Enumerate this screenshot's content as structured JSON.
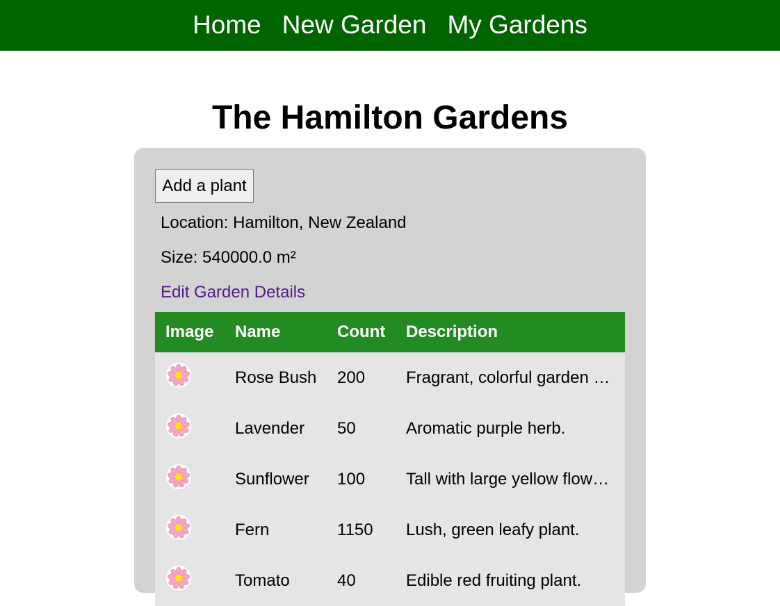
{
  "nav": {
    "items": [
      {
        "label": "Home"
      },
      {
        "label": "New Garden"
      },
      {
        "label": "My Gardens"
      }
    ]
  },
  "garden": {
    "title": "The Hamilton Gardens",
    "add_plant_label": "Add a plant",
    "location": "Location: Hamilton, New Zealand",
    "size": "Size: 540000.0 m²",
    "edit_label": "Edit Garden Details"
  },
  "table": {
    "headers": [
      "Image",
      "Name",
      "Count",
      "Description"
    ],
    "rows": [
      {
        "icon": "flower-icon",
        "name": "Rose Bush",
        "count": "200",
        "description": "Fragrant, colorful garden …"
      },
      {
        "icon": "flower-icon",
        "name": "Lavender",
        "count": "50",
        "description": "Aromatic purple herb."
      },
      {
        "icon": "flower-icon",
        "name": "Sunflower",
        "count": "100",
        "description": "Tall with large yellow flow…"
      },
      {
        "icon": "flower-icon",
        "name": "Fern",
        "count": "1150",
        "description": "Lush, green leafy plant."
      },
      {
        "icon": "flower-icon",
        "name": "Tomato",
        "count": "40",
        "description": "Edible red fruiting plant."
      }
    ]
  },
  "colors": {
    "nav_bg": "#006400",
    "table_header_bg": "#228b22",
    "card_bg": "#d3d3d3",
    "row_bg": "#e5e5e5",
    "link_visited": "#551a8b"
  }
}
